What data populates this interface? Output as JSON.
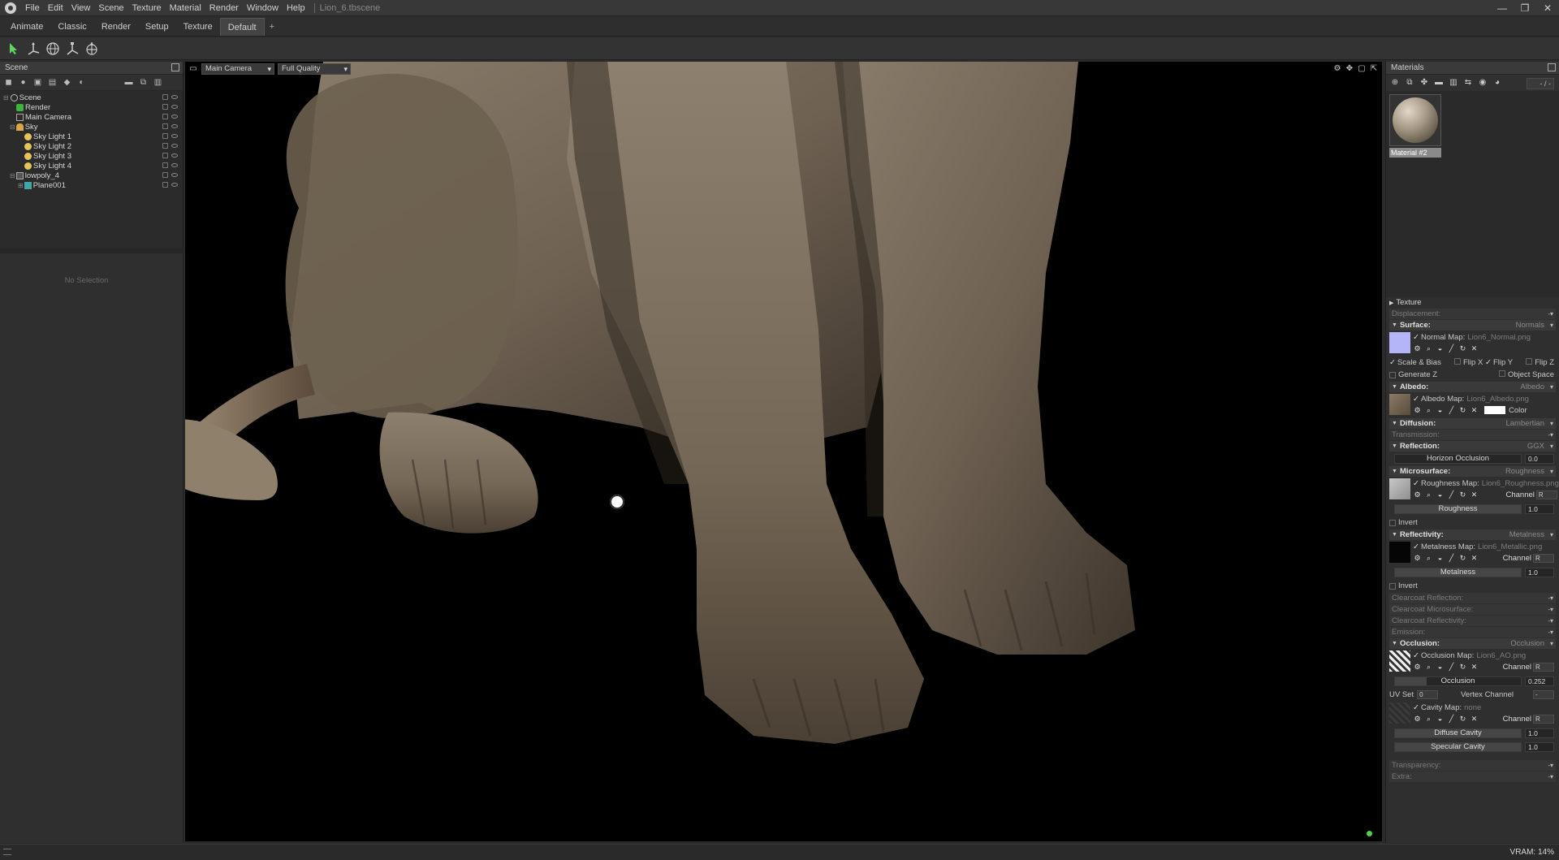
{
  "menubar": {
    "items": [
      "File",
      "Edit",
      "View",
      "Scene",
      "Texture",
      "Material",
      "Render",
      "Window",
      "Help"
    ],
    "doc_title": "Lion_6.tbscene",
    "controls": [
      "—",
      "❐",
      "✕"
    ]
  },
  "workspace_tabs": [
    "Animate",
    "Classic",
    "Render",
    "Setup",
    "Texture",
    "Default",
    "+"
  ],
  "active_tab": "Default",
  "scene_panel": {
    "title": "Scene",
    "tree": [
      {
        "label": "Scene",
        "depth": 0,
        "icon": "scene-icon"
      },
      {
        "label": "Render",
        "depth": 1,
        "icon": "render-icon"
      },
      {
        "label": "Main Camera",
        "depth": 1,
        "icon": "camera-icon"
      },
      {
        "label": "Sky",
        "depth": 1,
        "icon": "sky-icon"
      },
      {
        "label": "Sky Light 1",
        "depth": 2,
        "icon": "light-icon"
      },
      {
        "label": "Sky Light 2",
        "depth": 2,
        "icon": "light-icon"
      },
      {
        "label": "Sky Light 3",
        "depth": 2,
        "icon": "light-icon"
      },
      {
        "label": "Sky Light 4",
        "depth": 2,
        "icon": "light-icon"
      },
      {
        "label": "lowpoly_4",
        "depth": 1,
        "icon": "mesh-icon"
      },
      {
        "label": "Plane001",
        "depth": 2,
        "icon": "mesh-icon"
      }
    ],
    "no_selection": "No Selection"
  },
  "viewport": {
    "camera": "Main Camera",
    "quality": "Full Quality"
  },
  "materials_panel": {
    "title": "Materials",
    "counter": "- / -",
    "material_name": "Material #2"
  },
  "props": {
    "texture": "Texture",
    "displacement": "Displacement:",
    "surface": {
      "label": "Surface:",
      "value": "Normals"
    },
    "normal_map": {
      "label": "Normal Map:",
      "file": "Lion6_Normal.png"
    },
    "scale_bias": "Scale & Bias",
    "flip_x": "Flip X",
    "flip_y": "Flip Y",
    "flip_z": "Flip Z",
    "generate_z": "Generate Z",
    "object_space": "Object Space",
    "albedo": {
      "label": "Albedo:",
      "value": "Albedo"
    },
    "albedo_map": {
      "label": "Albedo Map:",
      "file": "Lion6_Albedo.png"
    },
    "color": "Color",
    "diffusion": {
      "label": "Diffusion:",
      "value": "Lambertian"
    },
    "transmission": "Transmission:",
    "reflection": {
      "label": "Reflection:",
      "value": "GGX"
    },
    "horizon_occlusion": {
      "label": "Horizon Occlusion",
      "value": "0.0",
      "fraction": 0
    },
    "microsurface": {
      "label": "Microsurface:",
      "value": "Roughness"
    },
    "roughness_map": {
      "label": "Roughness Map:",
      "file": "Lion6_Roughness.png"
    },
    "channel": "Channel",
    "channel_value": "R",
    "roughness": {
      "label": "Roughness",
      "value": "1.0",
      "fraction": 1
    },
    "invert": "Invert",
    "reflectivity": {
      "label": "Reflectivity:",
      "value": "Metalness"
    },
    "metalness_map": {
      "label": "Metalness Map:",
      "file": "Lion6_Metallic.png"
    },
    "metalness": {
      "label": "Metalness",
      "value": "1.0",
      "fraction": 1
    },
    "clearcoat_reflection": "Clearcoat Reflection:",
    "clearcoat_microsurface": "Clearcoat Microsurface:",
    "clearcoat_reflectivity": "Clearcoat Reflectivity:",
    "emission": "Emission:",
    "occlusion": {
      "label": "Occlusion:",
      "value": "Occlusion"
    },
    "occlusion_map": {
      "label": "Occlusion Map:",
      "file": "Lion6_AO.png"
    },
    "occlusion_slider": {
      "label": "Occlusion",
      "value": "0.252",
      "fraction": 0.252
    },
    "uv_set": {
      "label": "UV Set",
      "value": "0"
    },
    "vertex_channel": {
      "label": "Vertex Channel",
      "value": "-"
    },
    "cavity_map": {
      "label": "Cavity Map:",
      "file": "none"
    },
    "diffuse_cavity": {
      "label": "Diffuse Cavity",
      "value": "1.0",
      "fraction": 1
    },
    "specular_cavity": {
      "label": "Specular Cavity",
      "value": "1.0",
      "fraction": 1
    },
    "transparency": "Transparency:",
    "extra": "Extra:",
    "dash": "-"
  },
  "status": {
    "vram": "VRAM: 14%"
  },
  "colors": {
    "accent_green": "#4fd14f",
    "normal_swatch": "#b4b4f8"
  }
}
